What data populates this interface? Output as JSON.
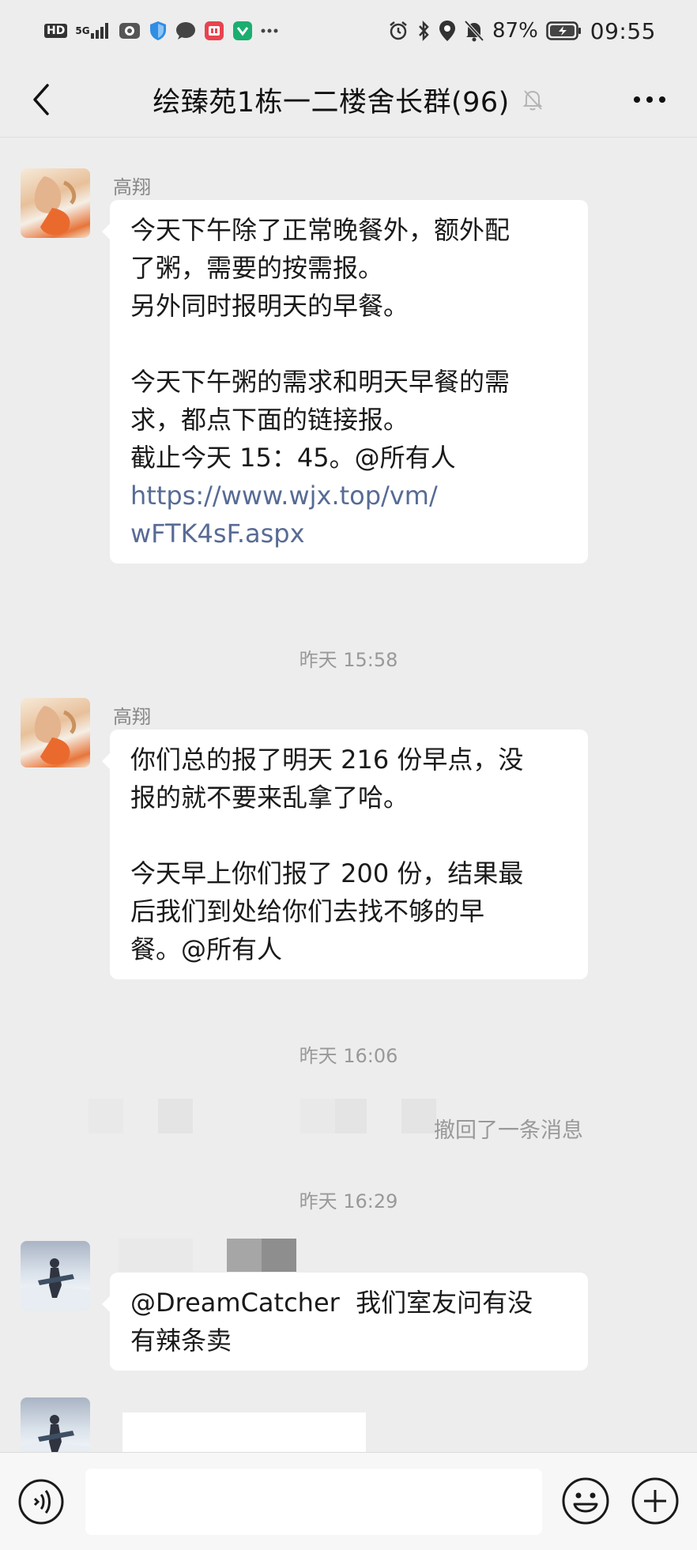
{
  "status_bar": {
    "hd": "HD",
    "net": "5G",
    "battery_pct": "87%",
    "time": "09:55"
  },
  "nav": {
    "title": "绘臻苑1栋一二楼舍长群(96)"
  },
  "messages": [
    {
      "sender": "高翔",
      "text_lines": "今天下午除了正常晚餐外，额外配\n了粥，需要的按需报。\n另外同时报明天的早餐。\n\n今天下午粥的需求和明天早餐的需\n求，都点下面的链接报。\n截止今天 15：45。@所有人\n",
      "link": "https://www.wjx.top/vm/\nwFTK4sF.aspx"
    },
    {
      "sender": "高翔",
      "text_lines": "你们总的报了明天 216 份早点，没\n报的就不要来乱拿了哈。\n\n今天早上你们报了 200 份，结果最\n后我们到处给你们去找不够的早\n餐。@所有人"
    },
    {
      "text_lines": "@DreamCatcher  我们室友问有没\n有辣条卖"
    }
  ],
  "timestamps": [
    "昨天 15:58",
    "昨天 16:06",
    "昨天 16:29"
  ],
  "recall_text": "撤回了一条消息",
  "input": {
    "placeholder": ""
  },
  "colors": {
    "background": "#ededed",
    "bubble": "#ffffff",
    "link": "#576b95",
    "timestamp": "#999999"
  },
  "icons": {
    "back": "chevron-left-icon",
    "mute": "bell-off-icon",
    "more": "more-dots-icon",
    "voice": "voice-icon",
    "emoji": "emoji-icon",
    "plus": "plus-icon"
  }
}
